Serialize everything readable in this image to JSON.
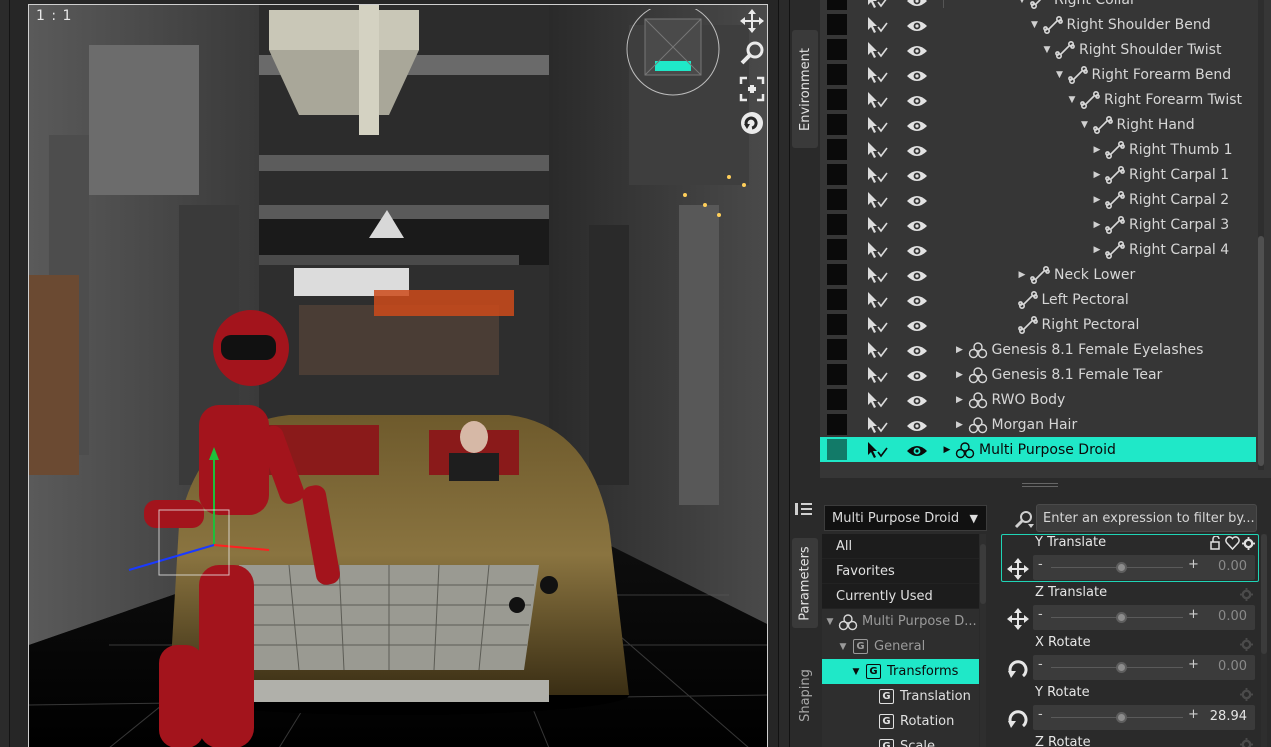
{
  "viewport": {
    "zoom_label": "1 : 1",
    "tools": [
      "move-icon",
      "zoom-icon",
      "frame-icon",
      "rotate-icon"
    ]
  },
  "side_tabs": {
    "top": [
      "Environment"
    ],
    "bottom": [
      "Parameters",
      "Shaping"
    ]
  },
  "scene_tree": {
    "rows": [
      {
        "label": "Right Collar",
        "level": 6,
        "arrow": "down",
        "icon": "bone-icon",
        "selected": false
      },
      {
        "label": "Right Shoulder Bend",
        "level": 7,
        "arrow": "down",
        "icon": "bone-icon",
        "selected": false
      },
      {
        "label": "Right Shoulder Twist",
        "level": 8,
        "arrow": "down",
        "icon": "bone-icon",
        "selected": false
      },
      {
        "label": "Right Forearm Bend",
        "level": 9,
        "arrow": "down",
        "icon": "bone-icon",
        "selected": false
      },
      {
        "label": "Right Forearm Twist",
        "level": 10,
        "arrow": "down",
        "icon": "bone-icon",
        "selected": false
      },
      {
        "label": "Right Hand",
        "level": 11,
        "arrow": "down",
        "icon": "bone-icon",
        "selected": false
      },
      {
        "label": "Right Thumb 1",
        "level": 12,
        "arrow": "right",
        "icon": "bone-icon",
        "selected": false
      },
      {
        "label": "Right Carpal 1",
        "level": 12,
        "arrow": "right",
        "icon": "bone-icon",
        "selected": false
      },
      {
        "label": "Right Carpal 2",
        "level": 12,
        "arrow": "right",
        "icon": "bone-icon",
        "selected": false
      },
      {
        "label": "Right Carpal 3",
        "level": 12,
        "arrow": "right",
        "icon": "bone-icon",
        "selected": false
      },
      {
        "label": "Right Carpal 4",
        "level": 12,
        "arrow": "right",
        "icon": "bone-icon",
        "selected": false
      },
      {
        "label": "Neck Lower",
        "level": 6,
        "arrow": "right",
        "icon": "bone-icon",
        "selected": false
      },
      {
        "label": "Left Pectoral",
        "level": 5,
        "arrow": "none",
        "icon": "bone-icon",
        "selected": false
      },
      {
        "label": "Right Pectoral",
        "level": 5,
        "arrow": "none",
        "icon": "bone-icon",
        "selected": false
      },
      {
        "label": "Genesis 8.1 Female Eyelashes",
        "level": 1,
        "arrow": "right",
        "icon": "figure-icon",
        "selected": false
      },
      {
        "label": "Genesis 8.1 Female Tear",
        "level": 1,
        "arrow": "right",
        "icon": "figure-icon",
        "selected": false
      },
      {
        "label": "RWO Body",
        "level": 1,
        "arrow": "right",
        "icon": "figure-icon",
        "selected": false
      },
      {
        "label": "Morgan Hair",
        "level": 1,
        "arrow": "right",
        "icon": "figure-icon",
        "selected": false
      },
      {
        "label": "Multi Purpose Droid",
        "level": 0,
        "arrow": "right",
        "icon": "figure-icon",
        "selected": true
      }
    ]
  },
  "parameters": {
    "node_select": "Multi Purpose Droid",
    "filter_placeholder": "Enter an expression to filter by...",
    "categories": [
      {
        "label": "All",
        "type": "flat",
        "selected": false
      },
      {
        "label": "Favorites",
        "type": "flat",
        "selected": false
      },
      {
        "label": "Currently Used",
        "type": "flat",
        "selected": false
      },
      {
        "label": "Multi Purpose D...",
        "type": "tree",
        "level": 0,
        "arrow": "down",
        "icon": "figure-icon",
        "dim": true,
        "selected": false
      },
      {
        "label": "General",
        "type": "tree",
        "level": 1,
        "arrow": "down",
        "icon": "group-icon",
        "dim": true,
        "selected": false
      },
      {
        "label": "Transforms",
        "type": "tree",
        "level": 2,
        "arrow": "down",
        "icon": "group-icon",
        "dim": false,
        "selected": true
      },
      {
        "label": "Translation",
        "type": "tree",
        "level": 3,
        "arrow": "none",
        "icon": "group-icon",
        "dim": false,
        "selected": false
      },
      {
        "label": "Rotation",
        "type": "tree",
        "level": 3,
        "arrow": "none",
        "icon": "group-icon",
        "dim": false,
        "selected": false
      },
      {
        "label": "Scale",
        "type": "tree",
        "level": 3,
        "arrow": "none",
        "icon": "group-icon",
        "dim": false,
        "selected": false
      }
    ],
    "items": [
      {
        "name": "Y Translate",
        "value": "0.00",
        "kind": "translate",
        "selected": true
      },
      {
        "name": "Z Translate",
        "value": "0.00",
        "kind": "translate",
        "selected": false
      },
      {
        "name": "X Rotate",
        "value": "0.00",
        "kind": "rotate",
        "selected": false
      },
      {
        "name": "Y Rotate",
        "value": "28.94",
        "kind": "rotate",
        "selected": false
      },
      {
        "name": "Z Rotate",
        "value": "",
        "kind": "rotate",
        "selected": false
      }
    ],
    "minus_label": "-",
    "plus_label": "+"
  },
  "colors": {
    "accent": "#1fe8c8",
    "panel_bg": "#2a2a2a",
    "tree_bg": "#363636"
  }
}
